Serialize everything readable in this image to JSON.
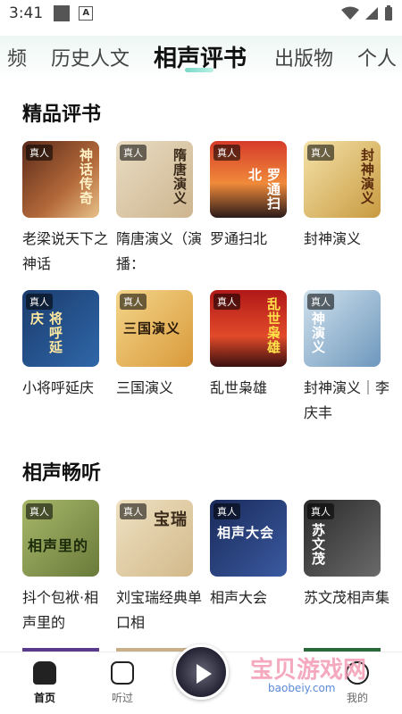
{
  "status": {
    "time": "3:41",
    "a_label": "A"
  },
  "tabs": [
    "频",
    "历史人文",
    "相声评书",
    "出版物",
    "个人"
  ],
  "sections": [
    {
      "title": "精品评书",
      "items": [
        {
          "badge": "真人",
          "title": "老梁说天下之神话",
          "cover_text": "神话传奇"
        },
        {
          "badge": "真人",
          "title": "隋唐演义（演播：",
          "cover_text": "隋唐演义"
        },
        {
          "badge": "真人",
          "title": "罗通扫北",
          "cover_text": "罗通扫北"
        },
        {
          "badge": "真人",
          "title": "封神演义",
          "cover_text": "封神演义"
        },
        {
          "badge": "真人",
          "title": "小将呼延庆",
          "cover_text": "将呼延庆"
        },
        {
          "badge": "真人",
          "title": "三国演义",
          "cover_text": "三国演义"
        },
        {
          "badge": "真人",
          "title": "乱世枭雄",
          "cover_text": "乱世枭雄"
        },
        {
          "badge": "真人",
          "title": "封神演义｜李庆丰",
          "cover_text": "神演义"
        }
      ]
    },
    {
      "title": "相声畅听",
      "items": [
        {
          "badge": "真人",
          "title": "抖个包袱·相声里的",
          "cover_text": "相声里的"
        },
        {
          "badge": "真人",
          "title": "刘宝瑞经典单口相",
          "cover_text": "宝瑞"
        },
        {
          "badge": "真人",
          "title": "相声大会",
          "cover_text": "相声大会"
        },
        {
          "badge": "真人",
          "title": "苏文茂相声集",
          "cover_text": "苏文茂"
        }
      ]
    }
  ],
  "nav": {
    "home": "首页",
    "listen": "听过",
    "mine": "我的"
  },
  "watermark": {
    "main": "宝贝游戏网",
    "sub": "baobeiy.com"
  }
}
